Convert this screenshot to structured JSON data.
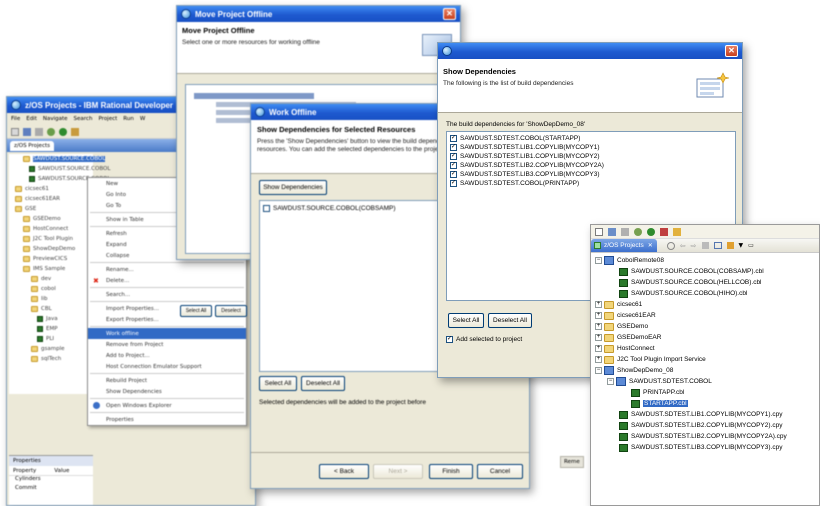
{
  "eclipse": {
    "title": "z/OS Projects - IBM Rational Developer",
    "menubar": [
      "File",
      "Edit",
      "Navigate",
      "Search",
      "Project",
      "Run",
      "W"
    ],
    "view_tab": "z/OS Projects",
    "tree": [
      {
        "label": "SAWDUST.SOURCE.COBOL"
      },
      {
        "label": "SAWDUST.SOURCE.COBOL"
      },
      {
        "label": "SAWDUST.SOURCE.COBOL"
      },
      {
        "label": "cicsec61"
      },
      {
        "label": "cicsec61EAR"
      },
      {
        "label": "GSE"
      },
      {
        "label": "GSEDemo"
      },
      {
        "label": "HostConnect"
      },
      {
        "label": "J2C Tool Plugin"
      },
      {
        "label": "ShowDepDemo"
      },
      {
        "label": "PreviewCICS"
      },
      {
        "label": "IMS Sample"
      },
      {
        "label": "dev"
      },
      {
        "label": "cobol"
      },
      {
        "label": "lib"
      },
      {
        "label": "CBL"
      },
      {
        "label": "Java"
      },
      {
        "label": "EMP"
      },
      {
        "label": "PLI"
      },
      {
        "label": "gsample"
      },
      {
        "label": "sqlTech"
      }
    ],
    "props_tab": "Properties",
    "props_cols": [
      "Property",
      "Value"
    ],
    "props_rows": [
      "Cylinders",
      "Commit"
    ],
    "context_menu": [
      {
        "label": "New",
        "sep": false
      },
      {
        "label": "Go Into",
        "sep": false
      },
      {
        "label": "Go To",
        "sep": true
      },
      {
        "label": "Show in Table",
        "sep": true
      },
      {
        "label": "Refresh",
        "sep": false
      },
      {
        "label": "Expand",
        "sep": false
      },
      {
        "label": "Collapse",
        "sep": true
      },
      {
        "label": "Rename...",
        "sep": false
      },
      {
        "label": "Delete...",
        "sep": true
      },
      {
        "label": "Search...",
        "sep": true
      },
      {
        "label": "Import Properties...",
        "sep": false
      },
      {
        "label": "Export Properties...",
        "sep": true
      },
      {
        "label": "Work offline",
        "sep": false,
        "selected": true
      },
      {
        "label": "Remove from Project",
        "sep": false
      },
      {
        "label": "Add to Project...",
        "sep": false
      },
      {
        "label": "Host Connection Emulator Support",
        "sep": true
      },
      {
        "label": "Rebuild Project",
        "sep": false
      },
      {
        "label": "Show Dependencies",
        "sep": true
      },
      {
        "label": "Open Windows Explorer",
        "sep": true
      },
      {
        "label": "Properties",
        "sep": false
      }
    ]
  },
  "move_offline": {
    "title": "Move Project Offline",
    "header_title": "Move Project Offline",
    "header_desc": "Select one or more resources for working offline"
  },
  "work_offline": {
    "title": "Work Offline",
    "header_title": "Show Dependencies for Selected Resources",
    "header_desc": "Press the 'Show Dependencies' button to view the build dependencies of the selected resources.  You can add the selected dependencies to the project before going offline.",
    "show_dep_button": "Show Dependencies",
    "items": [
      {
        "label": "SAWDUST.SOURCE.COBOL(COBSAMP)",
        "checked": false
      }
    ],
    "select_all": "Select All",
    "deselect_all": "Deselect All",
    "info_text": "Selected dependencies will be added to the project before",
    "back_button": "< Back",
    "next_button": "Next >",
    "finish_button": "Finish",
    "cancel_button": "Cancel",
    "bg_select_all": "Select All",
    "bg_deselect": "Deselect"
  },
  "show_deps": {
    "header_title": "Show Dependencies",
    "header_desc": "The following is the list of build dependencies",
    "list_caption": "The build dependencies for 'ShowDepDemo_08'",
    "items": [
      {
        "label": "SAWDUST.SDTEST.COBOL(STARTAPP)",
        "checked": true
      },
      {
        "label": "SAWDUST.SDTEST.LIB1.COPYLIB(MYCOPY1)",
        "checked": true
      },
      {
        "label": "SAWDUST.SDTEST.LIB1.COPYLIB(MYCOPY2)",
        "checked": true
      },
      {
        "label": "SAWDUST.SDTEST.LIB2.COPYLIB(MYCOPY2A)",
        "checked": true
      },
      {
        "label": "SAWDUST.SDTEST.LIB3.COPYLIB(MYCOPY3)",
        "checked": true
      },
      {
        "label": "SAWDUST.SDTEST.COBOL(PRINTAPP)",
        "checked": true
      }
    ],
    "select_all": "Select All",
    "deselect_all": "Deselect All",
    "add_checkbox": "Add selected to project",
    "add_checked": true
  },
  "projects_view": {
    "tab_label": "z/OS Projects",
    "tree": [
      {
        "label": "CobolRemote08",
        "kind": "project",
        "indent": 0,
        "toggle": "-"
      },
      {
        "label": "SAWDUST.SOURCE.COBOL(COBSAMP).cbl",
        "kind": "file",
        "indent": 2,
        "toggle": ""
      },
      {
        "label": "SAWDUST.SOURCE.COBOL(HELLCOB).cbl",
        "kind": "file",
        "indent": 2,
        "toggle": ""
      },
      {
        "label": "SAWDUST.SOURCE.COBOL(HIHO).cbl",
        "kind": "file",
        "indent": 2,
        "toggle": ""
      },
      {
        "label": "cicsec61",
        "kind": "folder",
        "indent": 0,
        "toggle": "+"
      },
      {
        "label": "cicsec61EAR",
        "kind": "folder",
        "indent": 0,
        "toggle": "+"
      },
      {
        "label": "GSEDemo",
        "kind": "folder",
        "indent": 0,
        "toggle": "+"
      },
      {
        "label": "GSEDemoEAR",
        "kind": "folder",
        "indent": 0,
        "toggle": "+"
      },
      {
        "label": "HostConnect",
        "kind": "folder",
        "indent": 0,
        "toggle": "+"
      },
      {
        "label": "J2C Tool Plugin Import Service",
        "kind": "folder",
        "indent": 0,
        "toggle": "+"
      },
      {
        "label": "ShowDepDemo_08",
        "kind": "project",
        "indent": 0,
        "toggle": "-"
      },
      {
        "label": "SAWDUST.SDTEST.COBOL",
        "kind": "project",
        "indent": 1,
        "toggle": "-"
      },
      {
        "label": "PRINTAPP.cbl",
        "kind": "file",
        "indent": 3,
        "toggle": ""
      },
      {
        "label": "STARTAPP.cbl",
        "kind": "file",
        "indent": 3,
        "toggle": "",
        "selected": true
      },
      {
        "label": "SAWDUST.SDTEST.LIB1.COPYLIB(MYCOPY1).cpy",
        "kind": "file",
        "indent": 2,
        "toggle": ""
      },
      {
        "label": "SAWDUST.SDTEST.LIB2.COPYLIB(MYCOPY2).cpy",
        "kind": "file",
        "indent": 2,
        "toggle": ""
      },
      {
        "label": "SAWDUST.SDTEST.LIB2.COPYLIB(MYCOPY2A).cpy",
        "kind": "file",
        "indent": 2,
        "toggle": ""
      },
      {
        "label": "SAWDUST.SDTEST.LIB3.COPYLIB(MYCOPY3).cpy",
        "kind": "file",
        "indent": 2,
        "toggle": ""
      }
    ],
    "behind_tab": "Remote Systems",
    "behind_tab_short": "Reme"
  }
}
